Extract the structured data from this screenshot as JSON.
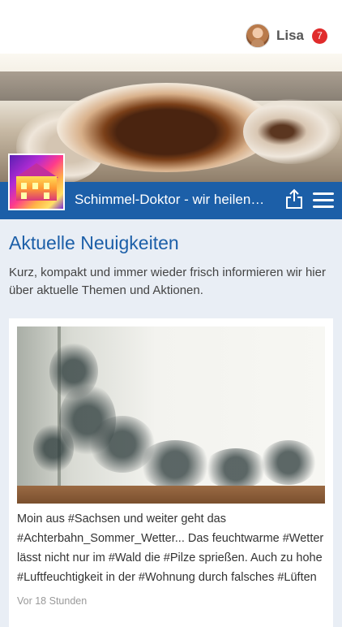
{
  "user": {
    "name": "Lisa",
    "notification_count": "7"
  },
  "site": {
    "title": "Schimmel-Doktor - wir heilen…"
  },
  "news": {
    "heading": "Aktuelle Neuigkeiten",
    "intro": "Kurz, kompakt und immer wieder frisch informieren wir hier über aktuelle Themen und Aktionen.",
    "posts": [
      {
        "text": "Moin aus #Sachsen und weiter geht das #Achterbahn_Sommer_Wetter... Das feuchtwarme #Wetter lässt nicht nur im #Wald die #Pilze sprießen. Auch zu hohe #Luftfeuchtigkeit in der #Wohnung durch falsches #Lüften",
        "time": "Vor 18 Stunden"
      }
    ]
  },
  "colors": {
    "brand_blue": "#1c5fa8",
    "badge_red": "#e02b2b",
    "background": "#e9eef5"
  },
  "icons": {
    "share": "share-icon",
    "menu": "hamburger-menu-icon"
  }
}
